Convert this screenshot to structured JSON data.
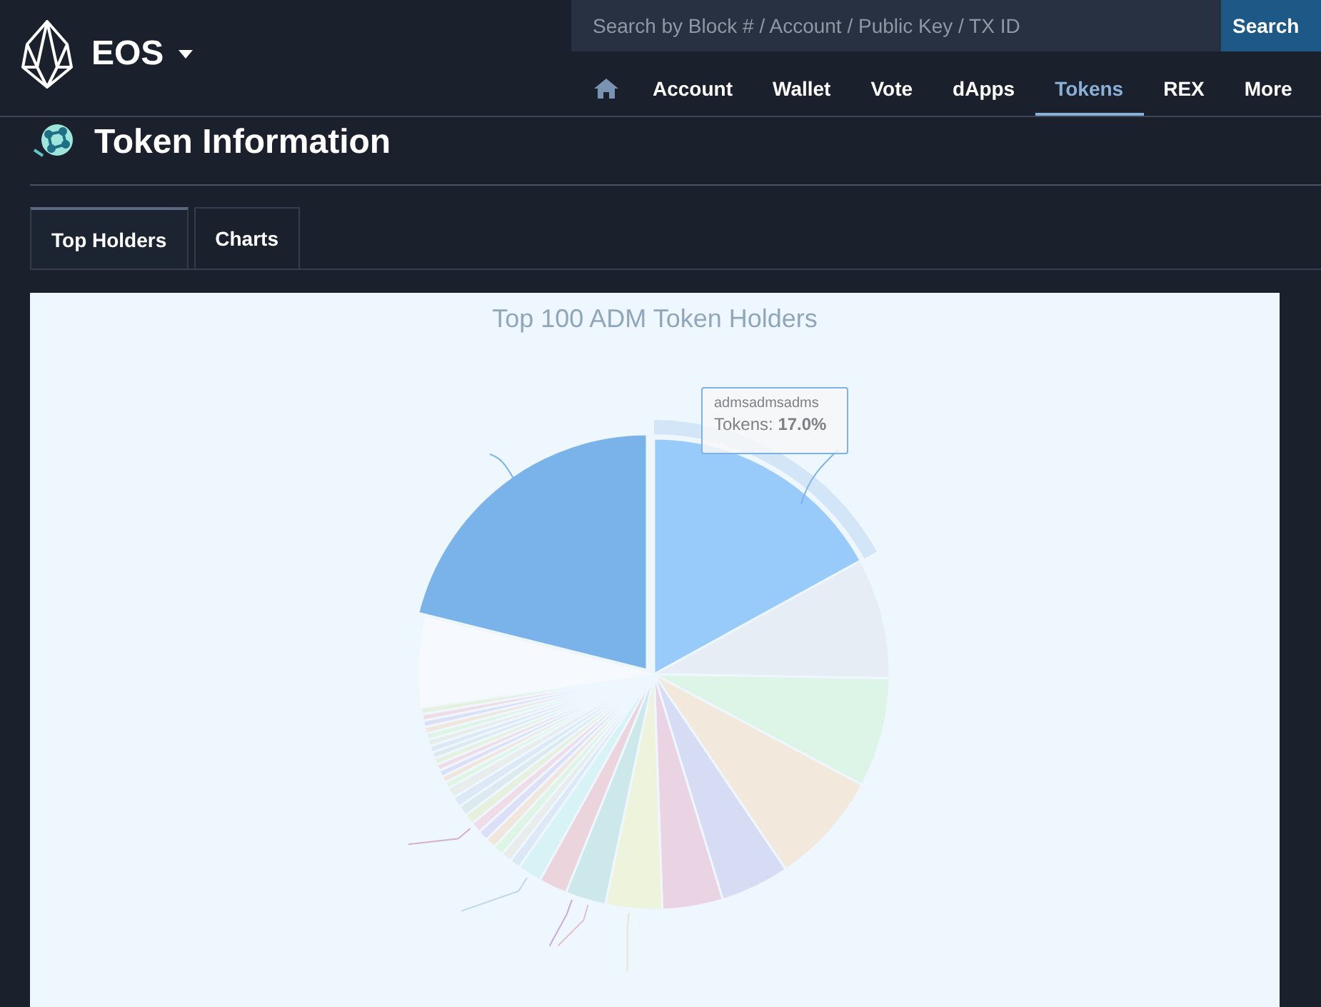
{
  "header": {
    "brand": "EOS",
    "search": {
      "placeholder": "Search by Block # / Account / Public Key / TX ID",
      "button": "Search"
    },
    "nav": [
      {
        "kind": "home",
        "selected": false
      },
      {
        "kind": "link",
        "label": "Account",
        "selected": false
      },
      {
        "kind": "link",
        "label": "Wallet",
        "selected": false
      },
      {
        "kind": "link",
        "label": "Vote",
        "selected": false
      },
      {
        "kind": "link",
        "label": "dApps",
        "selected": false
      },
      {
        "kind": "link",
        "label": "Tokens",
        "selected": true
      },
      {
        "kind": "link",
        "label": "REX",
        "selected": false
      },
      {
        "kind": "link",
        "label": "More",
        "selected": false
      }
    ]
  },
  "page": {
    "title": "Token Information",
    "tabs": [
      {
        "label": "Top Holders",
        "selected": true
      },
      {
        "label": "Charts",
        "selected": false
      }
    ],
    "chart": {
      "title": "Top 100 ADM Token Holders",
      "tooltip": {
        "name": "admsadmsadms",
        "text": "Tokens: **17.0%**"
      }
    }
  }
}
